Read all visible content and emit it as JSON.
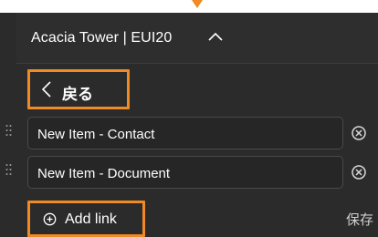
{
  "header": {
    "title": "Acacia Tower | EUI20"
  },
  "nav": {
    "back_label": "戻る"
  },
  "links": [
    {
      "label": "New Item - Contact"
    },
    {
      "label": "New Item - Document"
    }
  ],
  "footer": {
    "add_label": "Add link",
    "save_label": "保存"
  },
  "colors": {
    "highlight": "#f08a24",
    "panel_bg": "#2b2b2b",
    "row_border": "#4a4a4a",
    "text": "#ffffff"
  },
  "icons": [
    "chevron-up-icon",
    "chevron-left-icon",
    "drag-handle-icon",
    "remove-icon",
    "add-circle-icon"
  ]
}
